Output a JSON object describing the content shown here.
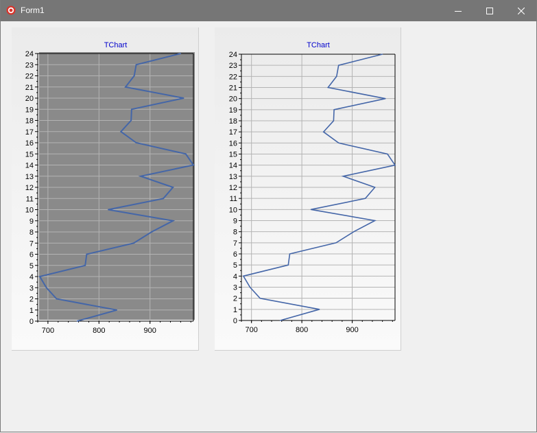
{
  "window": {
    "title": "Form1",
    "icon": "delphi-app-icon",
    "controls": [
      "minimize-icon",
      "maximize-icon",
      "close-icon"
    ]
  },
  "colors": {
    "titlebar": "#767676",
    "background": "#f0f0f0",
    "series": "#4466a8",
    "grid": "#b4b4b4",
    "title": "#0000cc"
  },
  "chart_data": [
    {
      "type": "line",
      "title": "TChart",
      "xlabel": "",
      "ylabel": "",
      "xlim": [
        680,
        985
      ],
      "ylim": [
        0,
        24
      ],
      "x_ticks": [
        700,
        800,
        900
      ],
      "y_ticks": [
        0,
        1,
        2,
        3,
        4,
        5,
        6,
        7,
        8,
        9,
        10,
        11,
        12,
        13,
        14,
        15,
        16,
        17,
        18,
        19,
        20,
        21,
        22,
        23,
        24
      ],
      "grid": true,
      "series": [
        {
          "x": [
            757,
            835,
            717,
            697,
            684,
            773,
            776,
            868,
            903,
            945,
            818,
            926,
            945,
            882,
            985,
            970,
            873,
            843,
            863,
            864,
            966,
            852,
            869,
            873,
            960
          ],
          "y": [
            0,
            1,
            2,
            3,
            4,
            5,
            6,
            7,
            8,
            9,
            10,
            11,
            12,
            13,
            14,
            15,
            16,
            17,
            18,
            19,
            20,
            21,
            22,
            23,
            24
          ]
        }
      ]
    },
    {
      "type": "line",
      "title": "TChart",
      "xlabel": "",
      "ylabel": "",
      "xlim": [
        680,
        985
      ],
      "ylim": [
        0,
        24
      ],
      "x_ticks": [
        700,
        800,
        900
      ],
      "y_ticks": [
        0,
        1,
        2,
        3,
        4,
        5,
        6,
        7,
        8,
        9,
        10,
        11,
        12,
        13,
        14,
        15,
        16,
        17,
        18,
        19,
        20,
        21,
        22,
        23,
        24
      ],
      "grid": true,
      "series": [
        {
          "x": [
            757,
            835,
            717,
            697,
            684,
            773,
            776,
            868,
            903,
            945,
            818,
            926,
            945,
            882,
            985,
            970,
            873,
            843,
            863,
            864,
            966,
            852,
            869,
            873,
            960
          ],
          "y": [
            0,
            1,
            2,
            3,
            4,
            5,
            6,
            7,
            8,
            9,
            10,
            11,
            12,
            13,
            14,
            15,
            16,
            17,
            18,
            19,
            20,
            21,
            22,
            23,
            24
          ]
        }
      ]
    }
  ]
}
